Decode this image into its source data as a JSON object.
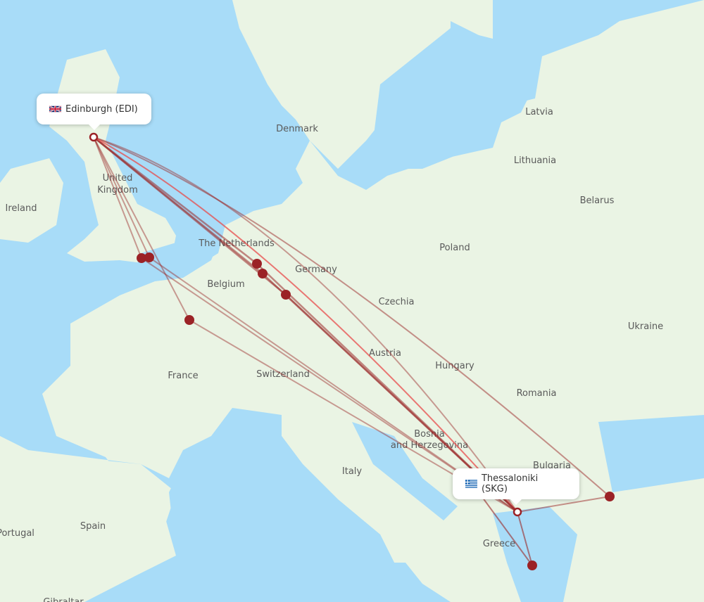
{
  "map": {
    "colors": {
      "water": "#a8dcf8",
      "land": "#eaf4e4",
      "border": "#8fcf8f",
      "route": "#9b2a2a",
      "route_alt": "#e84c4c",
      "marker": "#9b2226"
    },
    "labels": [
      {
        "name": "Ireland",
        "text": "Ireland"
      },
      {
        "name": "united-kingdom",
        "text": "United"
      },
      {
        "name": "united-kingdom-2",
        "text": "Kingdom"
      },
      {
        "name": "denmark",
        "text": "Denmark"
      },
      {
        "name": "netherlands",
        "text": "The Netherlands"
      },
      {
        "name": "belgium",
        "text": "Belgium"
      },
      {
        "name": "germany",
        "text": "Germany"
      },
      {
        "name": "poland",
        "text": "Poland"
      },
      {
        "name": "czechia",
        "text": "Czechia"
      },
      {
        "name": "austria",
        "text": "Austria"
      },
      {
        "name": "hungary",
        "text": "Hungary"
      },
      {
        "name": "switzerland",
        "text": "Switzerland"
      },
      {
        "name": "france",
        "text": "France"
      },
      {
        "name": "romania",
        "text": "Romania"
      },
      {
        "name": "ukraine",
        "text": "Ukraine"
      },
      {
        "name": "belarus",
        "text": "Belarus"
      },
      {
        "name": "lithuania",
        "text": "Lithuania"
      },
      {
        "name": "latvia",
        "text": "Latvia"
      },
      {
        "name": "bosnia",
        "text": "Bosnia"
      },
      {
        "name": "bosnia-2",
        "text": "and Herzegovina"
      },
      {
        "name": "bulgaria",
        "text": "Bulgaria"
      },
      {
        "name": "italy",
        "text": "Italy"
      },
      {
        "name": "greece",
        "text": "Greece"
      },
      {
        "name": "spain",
        "text": "Spain"
      },
      {
        "name": "portugal",
        "text": "Portugal"
      },
      {
        "name": "gibraltar",
        "text": "Gibraltar"
      }
    ]
  },
  "origin": {
    "city": "Edinburgh (EDI)",
    "flag": "uk-flag"
  },
  "destination": {
    "city": "Thessaloniki (SKG)",
    "flag": "greece-flag"
  }
}
